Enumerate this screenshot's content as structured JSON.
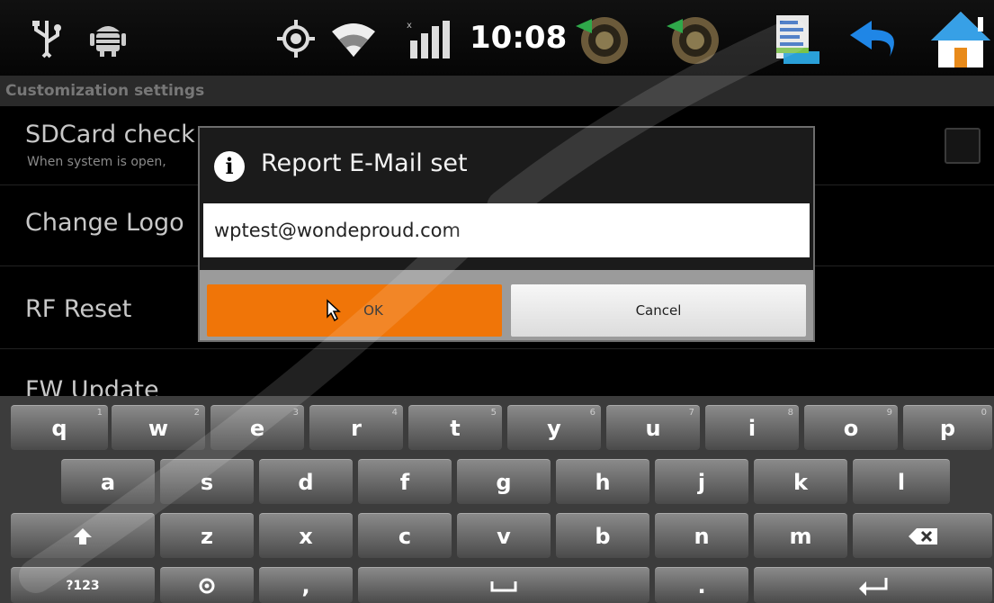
{
  "status_bar": {
    "time": "10:08",
    "icons": [
      "usb-icon",
      "android-debug-icon",
      "gps-icon",
      "wifi-icon",
      "signal-icon",
      "volume-down-icon",
      "volume-up-icon",
      "document-icon",
      "back-icon",
      "home-icon"
    ]
  },
  "section_header": "Customization settings",
  "settings": [
    {
      "title": "SDCard check",
      "subtitle": "When system is open,"
    },
    {
      "title": "Change Logo"
    },
    {
      "title": "RF Reset"
    },
    {
      "title": "FW Update"
    }
  ],
  "dialog": {
    "title": "Report E-Mail set",
    "email_value": "wptest@wondeproud.com",
    "ok_label": "OK",
    "cancel_label": "Cancel"
  },
  "keyboard": {
    "row1": [
      {
        "label": "q",
        "hint": "1"
      },
      {
        "label": "w",
        "hint": "2"
      },
      {
        "label": "e",
        "hint": "3"
      },
      {
        "label": "r",
        "hint": "4"
      },
      {
        "label": "t",
        "hint": "5"
      },
      {
        "label": "y",
        "hint": "6"
      },
      {
        "label": "u",
        "hint": "7"
      },
      {
        "label": "i",
        "hint": "8"
      },
      {
        "label": "o",
        "hint": "9"
      },
      {
        "label": "p",
        "hint": "0"
      }
    ],
    "row2": [
      "a",
      "s",
      "d",
      "f",
      "g",
      "h",
      "j",
      "k",
      "l"
    ],
    "row3": [
      "z",
      "x",
      "c",
      "v",
      "b",
      "n",
      "m"
    ],
    "symbols_label": "?123",
    "comma_label": ",",
    "period_label": "."
  },
  "colors": {
    "ok_button": "#f07508",
    "status_bar": "#0a0a0a",
    "keyboard_bg": "#3c3c3c"
  }
}
